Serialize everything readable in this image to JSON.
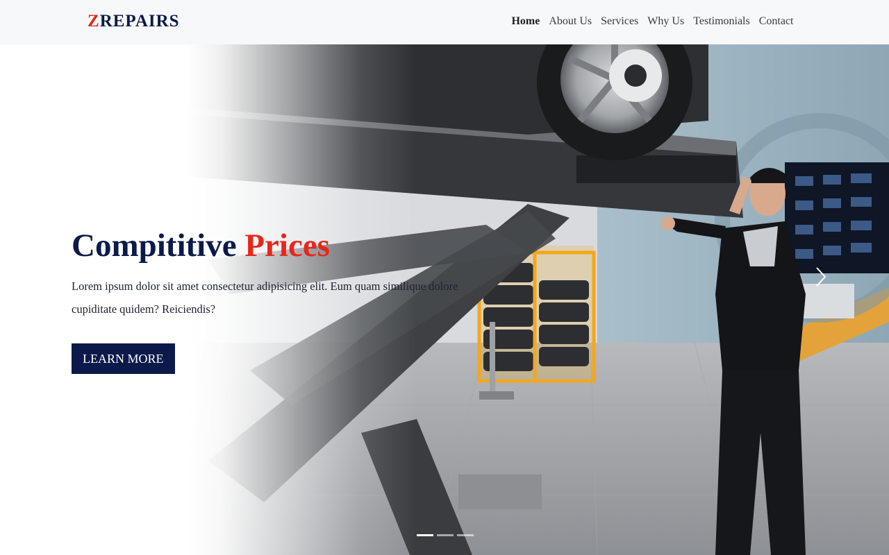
{
  "brand": {
    "first_letter": "Z",
    "rest": "REPAIRS"
  },
  "nav": {
    "items": [
      {
        "label": "Home",
        "active": true
      },
      {
        "label": "About Us",
        "active": false
      },
      {
        "label": "Services",
        "active": false
      },
      {
        "label": "Why Us",
        "active": false
      },
      {
        "label": "Testimonials",
        "active": false
      },
      {
        "label": "Contact",
        "active": false
      }
    ]
  },
  "hero": {
    "title_main": "Compititive",
    "title_accent": "Prices",
    "text": "Lorem ipsum dolor sit amet consectetur adipisicing elit. Eum quam similique dolore cupiditate quidem? Reiciendis?",
    "button_label": "LEARN MORE",
    "image_icon": "car-lift-mechanic-photo",
    "next_icon": "chevron-right-icon"
  },
  "carousel": {
    "slide_count": 3,
    "active_index": 0
  },
  "colors": {
    "brand_navy": "#0b1a4a",
    "accent_red": "#e8261a",
    "navbar_bg": "#f7f8f9"
  }
}
